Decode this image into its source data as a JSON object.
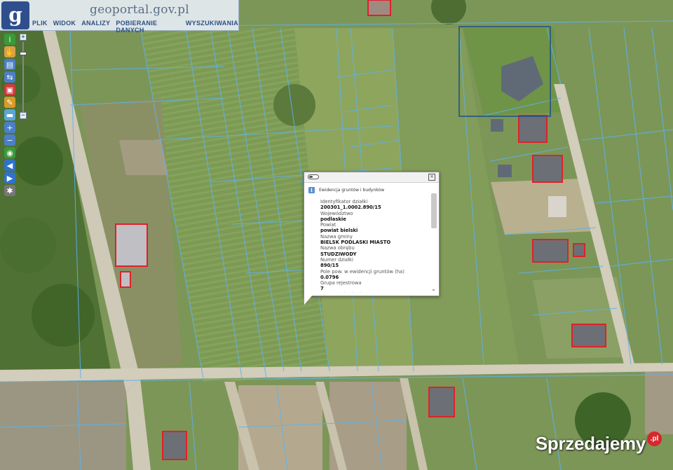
{
  "header": {
    "logo_letter": "g",
    "site_title": "geoportal.gov.pl",
    "menu": [
      "PLIK",
      "WIDOK",
      "ANALIZY",
      "POBIERANIE DANYCH",
      "WYSZUKIWANIA"
    ]
  },
  "toolbar": {
    "tools": [
      {
        "icon": "info-icon",
        "color": "#3a9a3a",
        "glyph": "i"
      },
      {
        "icon": "hand-pan-icon",
        "color": "#d7a048",
        "glyph": "✋"
      },
      {
        "icon": "document-icon",
        "color": "#4b7fc6",
        "glyph": "▤"
      },
      {
        "icon": "select-icon",
        "color": "#4b7fc6",
        "glyph": "⇆"
      },
      {
        "icon": "rectangle-select-icon",
        "color": "#cf3b3b",
        "glyph": "▣"
      },
      {
        "icon": "pencil-icon",
        "color": "#d89a2a",
        "glyph": "✎"
      },
      {
        "icon": "ruler-icon",
        "color": "#5aa6d8",
        "glyph": "▬"
      },
      {
        "icon": "zoom-in-icon",
        "color": "#4b7fc6",
        "glyph": "+"
      },
      {
        "icon": "zoom-out-icon",
        "color": "#4b7fc6",
        "glyph": "−"
      },
      {
        "icon": "globe-icon",
        "color": "#3a9a3a",
        "glyph": "◉"
      },
      {
        "icon": "arrow-back-icon",
        "color": "#2f73c9",
        "glyph": "◀"
      },
      {
        "icon": "arrow-forward-icon",
        "color": "#2f73c9",
        "glyph": "▶"
      },
      {
        "icon": "settings-icon",
        "color": "#777777",
        "glyph": "✱"
      }
    ],
    "zoom_plus": "+",
    "zoom_minus": "−"
  },
  "popup": {
    "title": "Ewidencja gruntów i budynków",
    "rows": [
      {
        "label": "Identyfikator działki",
        "value": "200301_1.0002.890/15"
      },
      {
        "label": "Województwo",
        "value": "podlaskie"
      },
      {
        "label": "Powiat",
        "value": "powiat bielski"
      },
      {
        "label": "Nazwa gminy",
        "value": "BIELSK PODLASKI MIASTO"
      },
      {
        "label": "Nazwa obrębu",
        "value": "STUDZIWODY"
      },
      {
        "label": "Numer działki",
        "value": "890/15"
      },
      {
        "label": "Pole pow. w ewidencji gruntów (ha)",
        "value": "0.0796"
      },
      {
        "label": "Grupa rejestrowa",
        "value": "7"
      },
      {
        "label": "Oznaczenie użytku",
        "value": ""
      }
    ],
    "close_glyph": "×",
    "scroll_down_glyph": "⌄"
  },
  "watermark": {
    "text": "Sprzedajemy",
    "badge": ".pl"
  },
  "map": {
    "parcel_line_color": "#5cb3f0",
    "building_outline_color": "#e0202a",
    "road_color": "#cfc9b8"
  }
}
